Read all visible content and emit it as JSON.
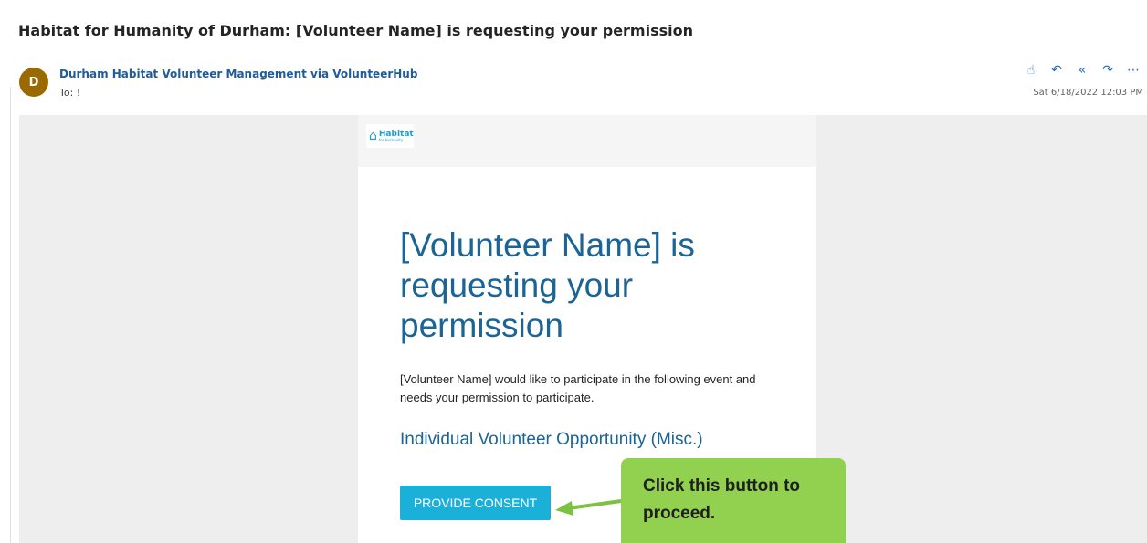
{
  "email": {
    "subject": "Habitat for Humanity of Durham: [Volunteer Name] is requesting your permission",
    "avatar_initial": "D",
    "sender": "Durham Habitat Volunteer Management via VolunteerHub",
    "to": "To: !",
    "date": "Sat 6/18/2022 12:03 PM",
    "actions": [
      {
        "name": "like-icon",
        "glyph": "☝"
      },
      {
        "name": "reply-icon",
        "glyph": "↶"
      },
      {
        "name": "reply-all-icon",
        "glyph": "«"
      },
      {
        "name": "forward-icon",
        "glyph": "↷"
      },
      {
        "name": "more-icon",
        "glyph": "⋯"
      }
    ]
  },
  "body": {
    "logo_text": "Habitat",
    "logo_subtext": "for Humanity",
    "headline": "[Volunteer Name] is requesting your permission",
    "message": "[Volunteer Name] would like to participate in the following event and needs your permission to participate.",
    "event_title": "Individual Volunteer Opportunity (Misc.)",
    "consent_button": "PROVIDE CONSENT"
  },
  "annotation": {
    "callout_text": "Click this button to proceed."
  },
  "colors": {
    "brand_blue": "#1a6496",
    "button_cyan": "#1bb0d8",
    "callout_green": "#92d050",
    "avatar_brown": "#9a6a00"
  }
}
